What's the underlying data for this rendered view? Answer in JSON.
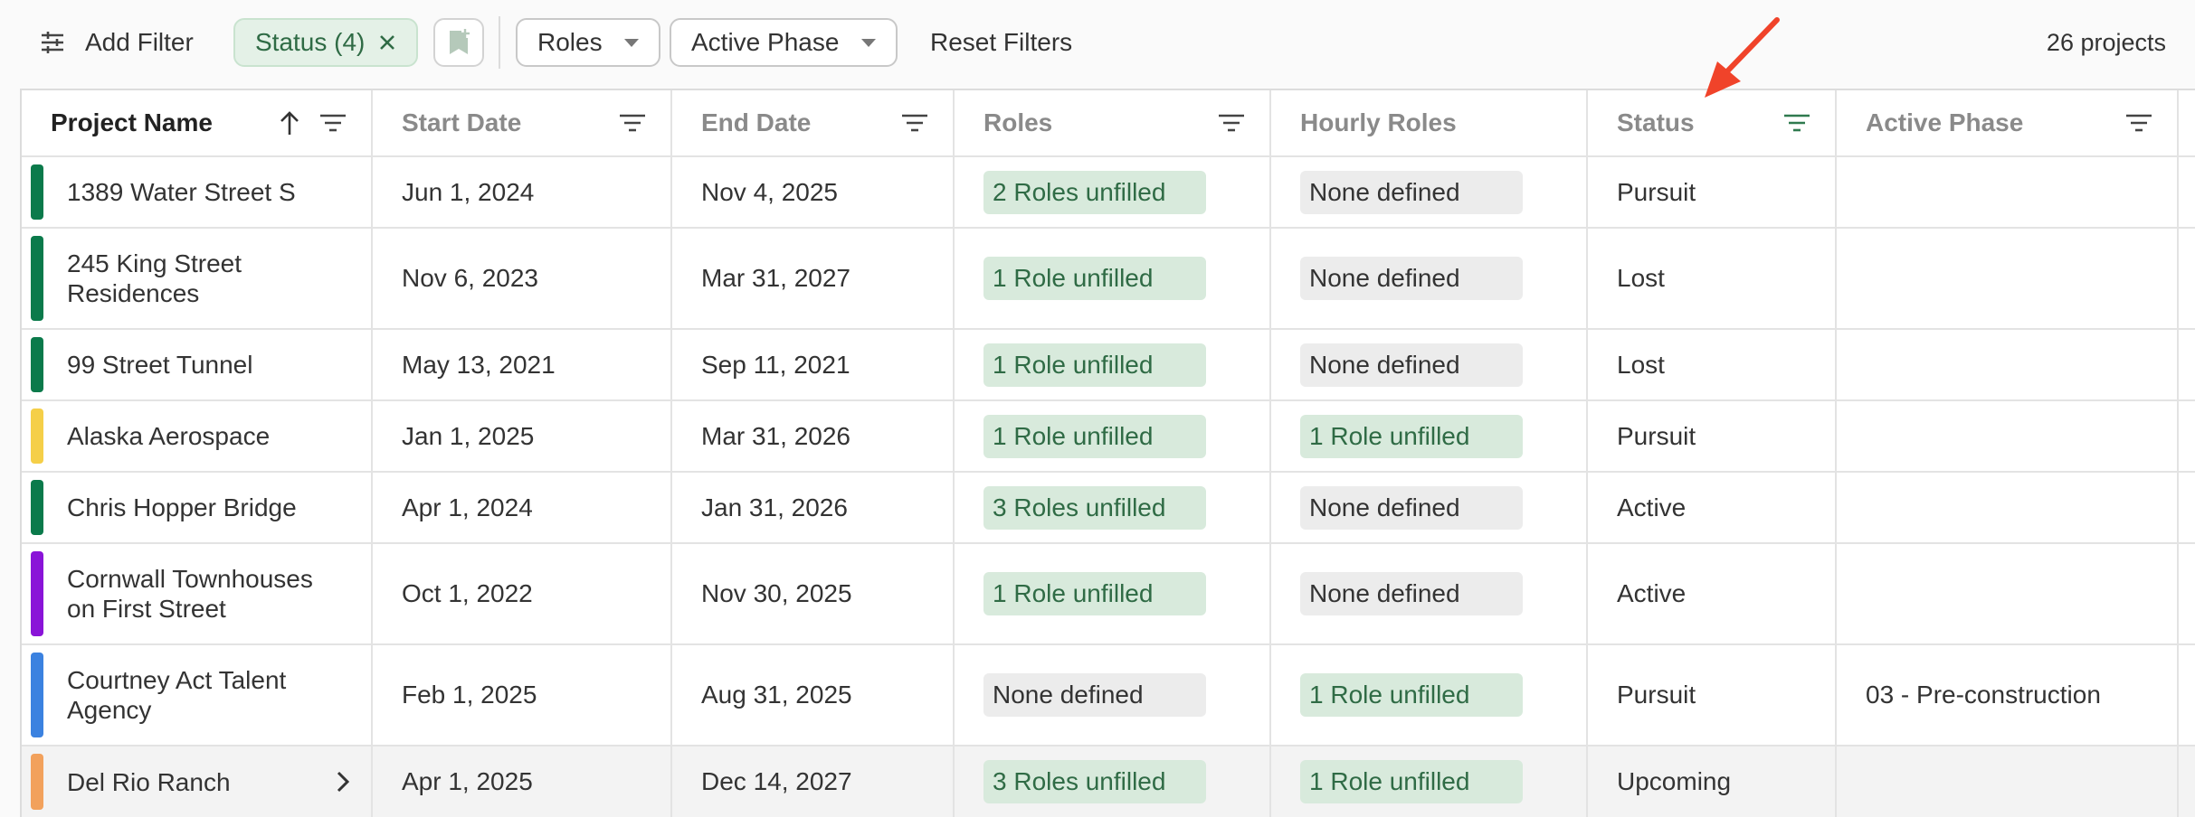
{
  "toolbar": {
    "add_filter": "Add Filter",
    "status_chip": "Status (4)",
    "roles_dropdown": "Roles",
    "phase_dropdown": "Active Phase",
    "reset_filters": "Reset Filters",
    "project_count": "26 projects"
  },
  "columns": [
    "Project Name",
    "Start Date",
    "End Date",
    "Roles",
    "Hourly Roles",
    "Status",
    "Active Phase"
  ],
  "rows": [
    {
      "name": "1389 Water Street S",
      "color": "#0b7a4b",
      "start": "Jun 1, 2024",
      "end": "Nov 4, 2025",
      "roles": "2 Roles unfilled",
      "hourly": "None defined",
      "status": "Pursuit",
      "phase": ""
    },
    {
      "name": "245 King Street Residences",
      "color": "#0b7a4b",
      "start": "Nov 6, 2023",
      "end": "Mar 31, 2027",
      "roles": "1 Role unfilled",
      "hourly": "None defined",
      "status": "Lost",
      "phase": ""
    },
    {
      "name": "99 Street Tunnel",
      "color": "#0b7a4b",
      "start": "May 13, 2021",
      "end": "Sep 11, 2021",
      "roles": "1 Role unfilled",
      "hourly": "None defined",
      "status": "Lost",
      "phase": ""
    },
    {
      "name": "Alaska Aerospace",
      "color": "#f5cf48",
      "start": "Jan 1, 2025",
      "end": "Mar 31, 2026",
      "roles": "1 Role unfilled",
      "hourly": "1 Role unfilled",
      "status": "Pursuit",
      "phase": ""
    },
    {
      "name": "Chris Hopper Bridge",
      "color": "#0b7a4b",
      "start": "Apr 1, 2024",
      "end": "Jan 31, 2026",
      "roles": "3 Roles unfilled",
      "hourly": "None defined",
      "status": "Active",
      "phase": ""
    },
    {
      "name": "Cornwall Townhouses on First Street",
      "color": "#8a14d8",
      "start": "Oct 1, 2022",
      "end": "Nov 30, 2025",
      "roles": "1 Role unfilled",
      "hourly": "None defined",
      "status": "Active",
      "phase": ""
    },
    {
      "name": "Courtney Act Talent Agency",
      "color": "#3b82e0",
      "start": "Feb 1, 2025",
      "end": "Aug 31, 2025",
      "roles": "None defined",
      "hourly": "1 Role unfilled",
      "status": "Pursuit",
      "phase": "03 - Pre-construction"
    },
    {
      "name": "Del Rio Ranch",
      "color": "#f2a15c",
      "start": "Apr 1, 2025",
      "end": "Dec 14, 2027",
      "roles": "3 Roles unfilled",
      "hourly": "1 Role unfilled",
      "status": "Upcoming",
      "phase": ""
    }
  ],
  "colors": {
    "accent_green": "#2f6b45",
    "pill_green": "#d8eadc",
    "pill_gray": "#ececec",
    "annotation_arrow": "#f0432a"
  },
  "icons": [
    "sliders-icon",
    "close-icon",
    "bookmark-add-icon",
    "chevron-down-icon",
    "sort-ascending-icon",
    "filter-icon",
    "chevron-right-icon",
    "annotation-arrow"
  ]
}
